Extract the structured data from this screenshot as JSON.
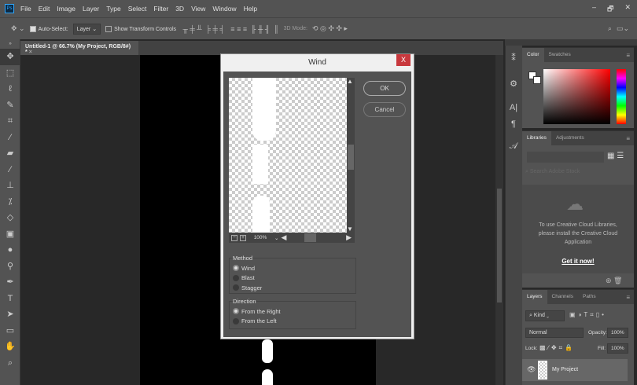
{
  "app": {
    "logo": "Ps",
    "menu": [
      "File",
      "Edit",
      "Image",
      "Layer",
      "Type",
      "Select",
      "Filter",
      "3D",
      "View",
      "Window",
      "Help"
    ],
    "window_controls": [
      "–",
      "🗗",
      "✕"
    ]
  },
  "options": {
    "auto_select_label": "Auto-Select:",
    "auto_select_checked": true,
    "layer_select": "Layer",
    "show_transform_label": "Show Transform Controls",
    "show_transform_checked": false,
    "mode3d_label": "3D Mode:"
  },
  "document_tab": {
    "title": "Untitled-1 @ 66.7% (My Project, RGB/8#) *",
    "close": "×"
  },
  "dialog": {
    "title": "Wind",
    "close": "X",
    "ok": "OK",
    "cancel": "Cancel",
    "zoom": "100%",
    "method": {
      "legend": "Method",
      "options": [
        "Wind",
        "Blast",
        "Stagger"
      ],
      "selected": "Wind"
    },
    "direction": {
      "legend": "Direction",
      "options": [
        "From the Right",
        "From the Left"
      ],
      "selected": "From the Right"
    }
  },
  "color_panel": {
    "tabs": [
      "Color",
      "Swatches"
    ],
    "active": "Color",
    "base_color": "#ff0000"
  },
  "libraries_panel": {
    "tabs": [
      "Libraries",
      "Adjustments"
    ],
    "active": "Libraries",
    "search_placeholder": "Search Adobe Stock",
    "message": "To use Creative Cloud Libraries, please install the Creative Cloud Application",
    "link": "Get it now!"
  },
  "layers_panel": {
    "tabs": [
      "Layers",
      "Channels",
      "Paths"
    ],
    "active": "Layers",
    "filter": "Kind",
    "blend_mode": "Normal",
    "opacity_label": "Opacity:",
    "opacity": "100%",
    "lock_label": "Lock:",
    "fill_label": "Fill:",
    "fill": "100%",
    "layers": [
      {
        "name": "My Project",
        "visible": true
      }
    ]
  }
}
